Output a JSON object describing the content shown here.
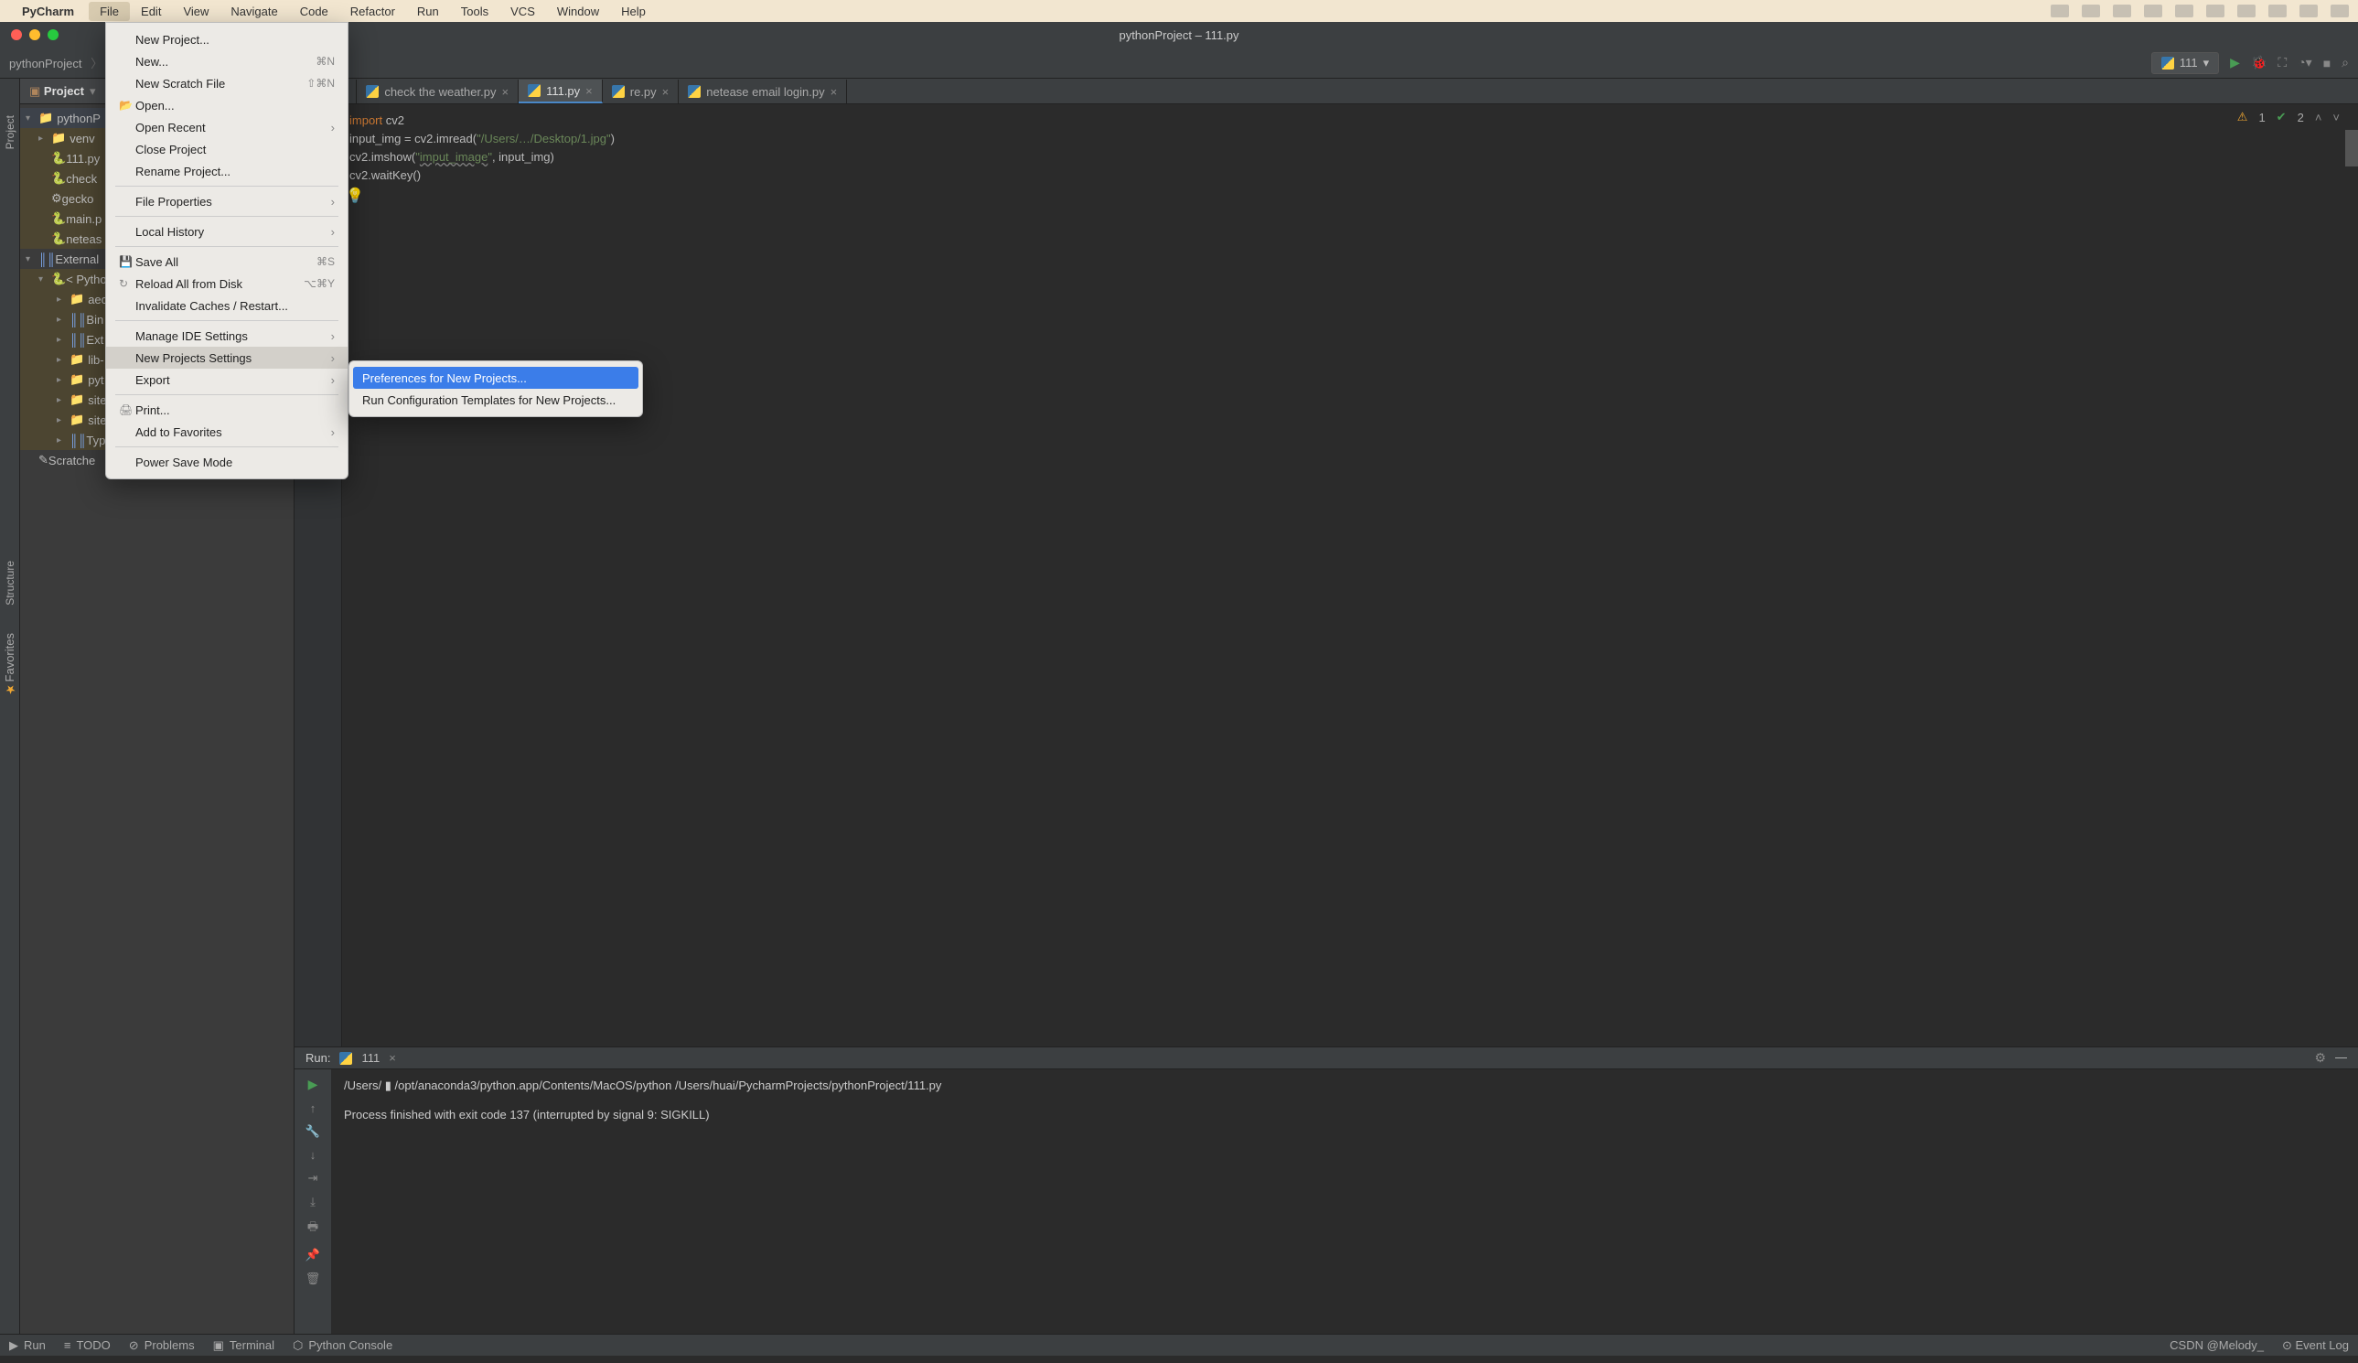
{
  "mac_menu": {
    "app": "PyCharm",
    "items": [
      "File",
      "Edit",
      "View",
      "Navigate",
      "Code",
      "Refactor",
      "Run",
      "Tools",
      "VCS",
      "Window",
      "Help"
    ],
    "active_index": 0
  },
  "window_title": "pythonProject – 111.py",
  "breadcrumb": {
    "project": "pythonProject",
    "file": "111.py"
  },
  "run_config_name": "111",
  "project_tool": {
    "title": "Project",
    "tree": [
      {
        "lvl": 0,
        "arr": "▾",
        "icon": "folder",
        "label": "pythonP",
        "hl": false,
        "sel": true
      },
      {
        "lvl": 1,
        "arr": "▸",
        "icon": "folder",
        "label": "venv",
        "hl": true
      },
      {
        "lvl": 1,
        "arr": "",
        "icon": "py",
        "label": "111.py",
        "hl": true
      },
      {
        "lvl": 1,
        "arr": "",
        "icon": "py",
        "label": "check",
        "hl": true
      },
      {
        "lvl": 1,
        "arr": "",
        "icon": "gecko",
        "label": "gecko",
        "hl": true
      },
      {
        "lvl": 1,
        "arr": "",
        "icon": "py",
        "label": "main.p",
        "hl": true
      },
      {
        "lvl": 1,
        "arr": "",
        "icon": "py",
        "label": "neteas",
        "hl": true
      },
      {
        "lvl": 0,
        "arr": "▾",
        "icon": "lib",
        "label": "External"
      },
      {
        "lvl": 1,
        "arr": "▾",
        "icon": "py",
        "label": "< Pytho",
        "hl": true
      },
      {
        "lvl": 2,
        "arr": "▸",
        "icon": "folder",
        "label": "aec",
        "hl": true
      },
      {
        "lvl": 2,
        "arr": "▸",
        "icon": "lib",
        "label": "Bin",
        "hl": true
      },
      {
        "lvl": 2,
        "arr": "▸",
        "icon": "lib",
        "label": "Ext",
        "hl": true
      },
      {
        "lvl": 2,
        "arr": "▸",
        "icon": "folder",
        "label": "lib-",
        "hl": true
      },
      {
        "lvl": 2,
        "arr": "▸",
        "icon": "folder",
        "label": "pyt",
        "hl": true
      },
      {
        "lvl": 2,
        "arr": "▸",
        "icon": "folder",
        "label": "site",
        "hl": true
      },
      {
        "lvl": 2,
        "arr": "▸",
        "icon": "folder",
        "label": "site",
        "hl": true
      },
      {
        "lvl": 2,
        "arr": "▸",
        "icon": "lib",
        "label": "Typ",
        "hl": true
      },
      {
        "lvl": 0,
        "arr": "",
        "icon": "scratch",
        "label": "Scratche"
      }
    ]
  },
  "tabs": [
    {
      "label": "py",
      "active": false
    },
    {
      "label": "check the weather.py",
      "active": false
    },
    {
      "label": "111.py",
      "active": true
    },
    {
      "label": "re.py",
      "active": false
    },
    {
      "label": "netease email login.py",
      "active": false
    }
  ],
  "code_lines": [
    {
      "t": "import",
      "k": "kw"
    },
    {
      "t": " cv2\n"
    },
    {
      "t": "input_img = cv2.imread(",
      "k": ""
    },
    {
      "t": "\"/Users/",
      "k": "str"
    },
    {
      "t": "…",
      "k": "str"
    },
    {
      "t": "/Desktop/1.jpg\"",
      "k": "str"
    },
    {
      "t": ")\n"
    },
    {
      "t": "cv2.imshow(",
      "k": ""
    },
    {
      "t": "\"",
      "k": "str"
    },
    {
      "t": "imput_image",
      "k": "str warn"
    },
    {
      "t": "\"",
      "k": "str"
    },
    {
      "t": ", input_img)\n"
    },
    {
      "t": "cv2.waitKey()\n"
    }
  ],
  "inspection": {
    "warn_count": "1",
    "ok_count": "2"
  },
  "run_panel": {
    "label": "Run:",
    "config": "111",
    "out_line1": "/Users/ ▮ /opt/anaconda3/python.app/Contents/MacOS/python /Users/huai/PycharmProjects/pythonProject/111.py",
    "out_line2": "",
    "out_line3": "Process finished with exit code 137 (interrupted by signal 9: SIGKILL)"
  },
  "tool_tabs": [
    {
      "icon": "▶",
      "label": "Run"
    },
    {
      "icon": "≡",
      "label": "TODO"
    },
    {
      "icon": "⊘",
      "label": "Problems"
    },
    {
      "icon": "▣",
      "label": "Terminal"
    },
    {
      "icon": "⬡",
      "label": "Python Console"
    }
  ],
  "status_right": [
    "CSDN @Melody_",
    "⊙ Event Log"
  ],
  "file_menu": {
    "items": [
      {
        "label": "New Project..."
      },
      {
        "label": "New...",
        "shortcut": "⌘N"
      },
      {
        "label": "New Scratch File",
        "shortcut": "⇧⌘N"
      },
      {
        "label": "Open...",
        "icon": "📂"
      },
      {
        "label": "Open Recent",
        "sub": true
      },
      {
        "label": "Close Project"
      },
      {
        "label": "Rename Project..."
      },
      {
        "sep": true
      },
      {
        "label": "File Properties",
        "sub": true
      },
      {
        "sep": true
      },
      {
        "label": "Local History",
        "sub": true
      },
      {
        "sep": true
      },
      {
        "label": "Save All",
        "shortcut": "⌘S",
        "icon": "💾"
      },
      {
        "label": "Reload All from Disk",
        "shortcut": "⌥⌘Y",
        "icon": "↻"
      },
      {
        "label": "Invalidate Caches / Restart..."
      },
      {
        "sep": true
      },
      {
        "label": "Manage IDE Settings",
        "sub": true
      },
      {
        "label": "New Projects Settings",
        "sub": true,
        "hover": true
      },
      {
        "label": "Export",
        "sub": true
      },
      {
        "sep": true
      },
      {
        "label": "Print...",
        "icon": "🖨"
      },
      {
        "label": "Add to Favorites",
        "sub": true
      },
      {
        "sep": true
      },
      {
        "label": "Power Save Mode"
      }
    ]
  },
  "submenu": {
    "items": [
      {
        "label": "Preferences for New Projects...",
        "sel": true
      },
      {
        "label": "Run Configuration Templates for New Projects..."
      }
    ]
  },
  "side_labels": {
    "project": "Project",
    "structure": "Structure",
    "favorites": "Favorites"
  }
}
